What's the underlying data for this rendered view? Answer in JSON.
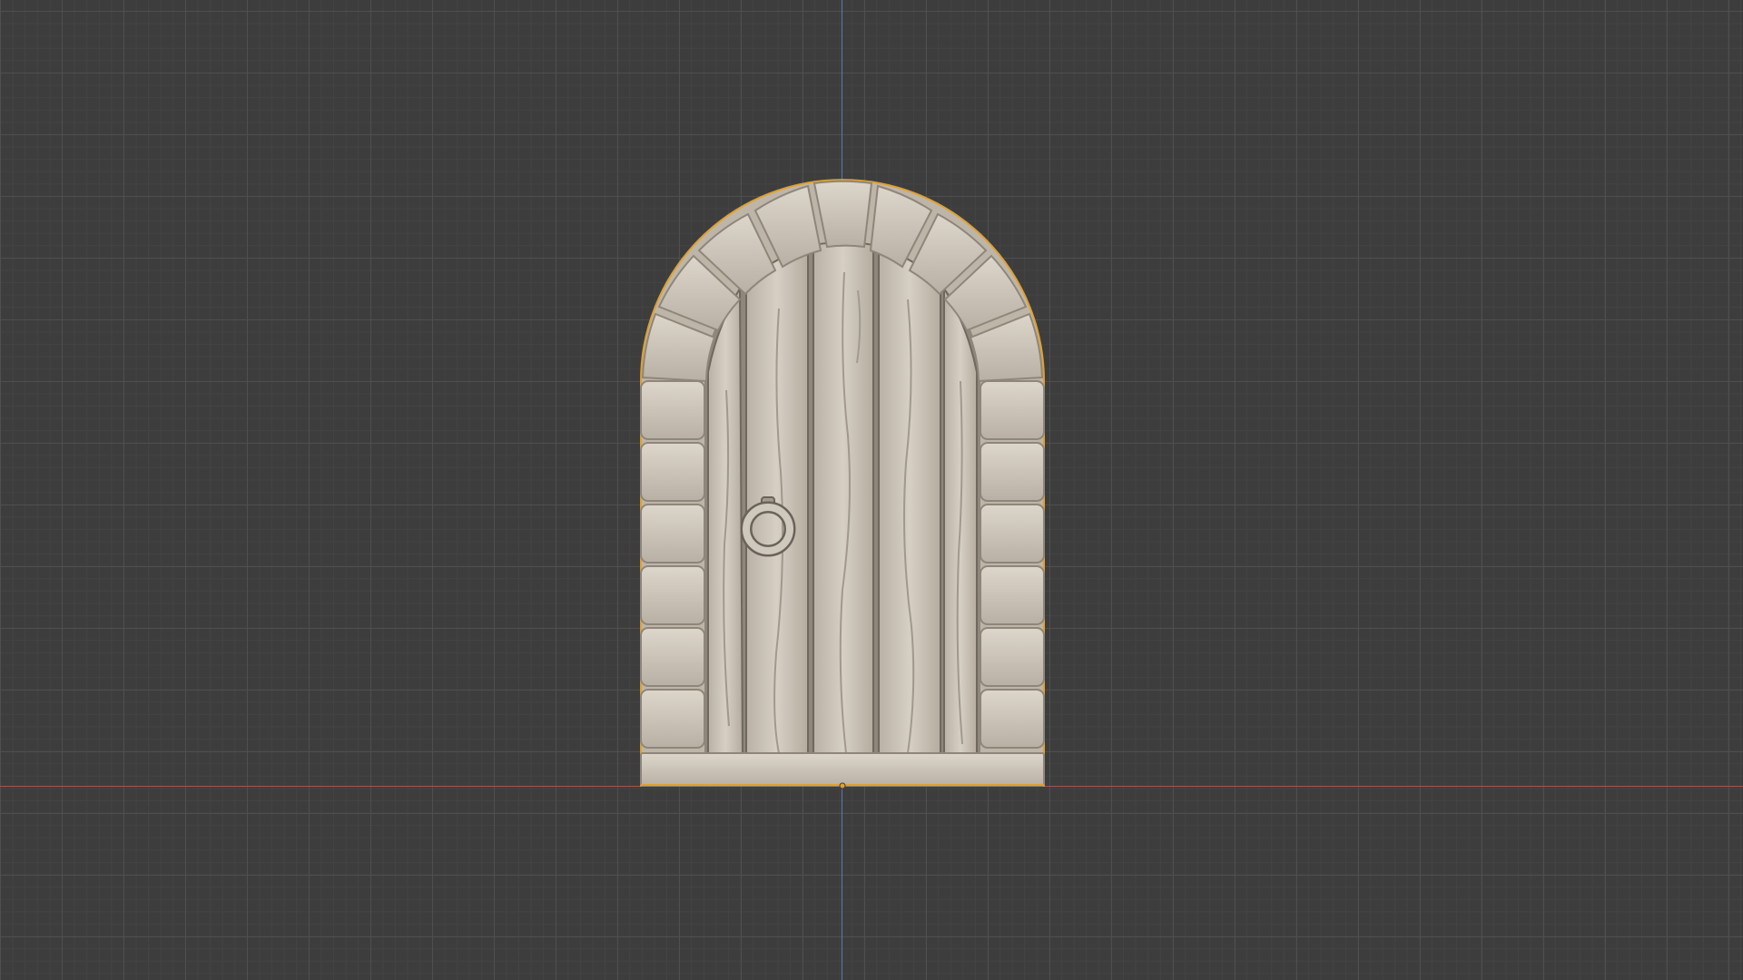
{
  "viewport": {
    "background_color": "#3d3d3d",
    "grid_color": "#505050",
    "x_axis_color": "#a35454",
    "y_axis_color": "#4f7fae"
  },
  "scene": {
    "object": "arched-door",
    "material_color": "#d2cbc0",
    "selection_outline_color": "#e0a030",
    "icons": [
      "door-ring-handle-icon",
      "origin-dot-icon"
    ]
  }
}
